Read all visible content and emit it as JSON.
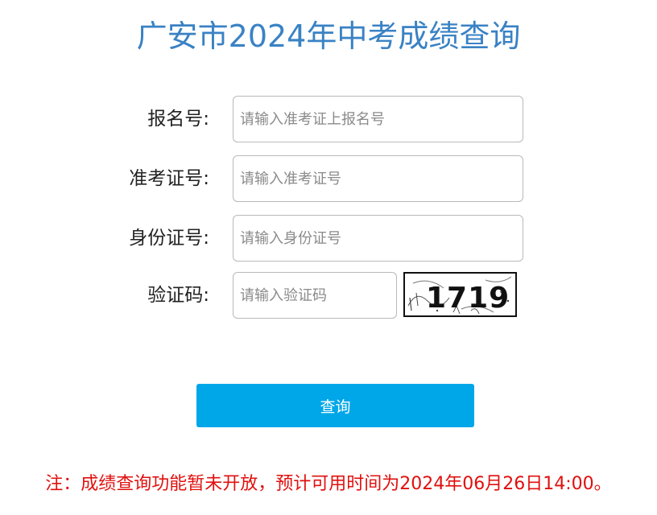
{
  "header": {
    "title": "广安市2024年中考成绩查询"
  },
  "form": {
    "registration_number": {
      "label": "报名号:",
      "placeholder": "请输入准考证上报名号",
      "value": ""
    },
    "exam_ticket_number": {
      "label": "准考证号:",
      "placeholder": "请输入准考证号",
      "value": ""
    },
    "id_number": {
      "label": "身份证号:",
      "placeholder": "请输入身份证号",
      "value": ""
    },
    "verification_code": {
      "label": "验证码:",
      "placeholder": "请输入验证码",
      "value": "",
      "captcha_text": "1719"
    },
    "submit_label": "查询"
  },
  "notice": {
    "text": "注：成绩查询功能暂未开放，预计可用时间为2024年06月26日14:00。"
  },
  "colors": {
    "title": "#3a82c4",
    "button": "#00a7e8",
    "notice": "#e0100e"
  }
}
